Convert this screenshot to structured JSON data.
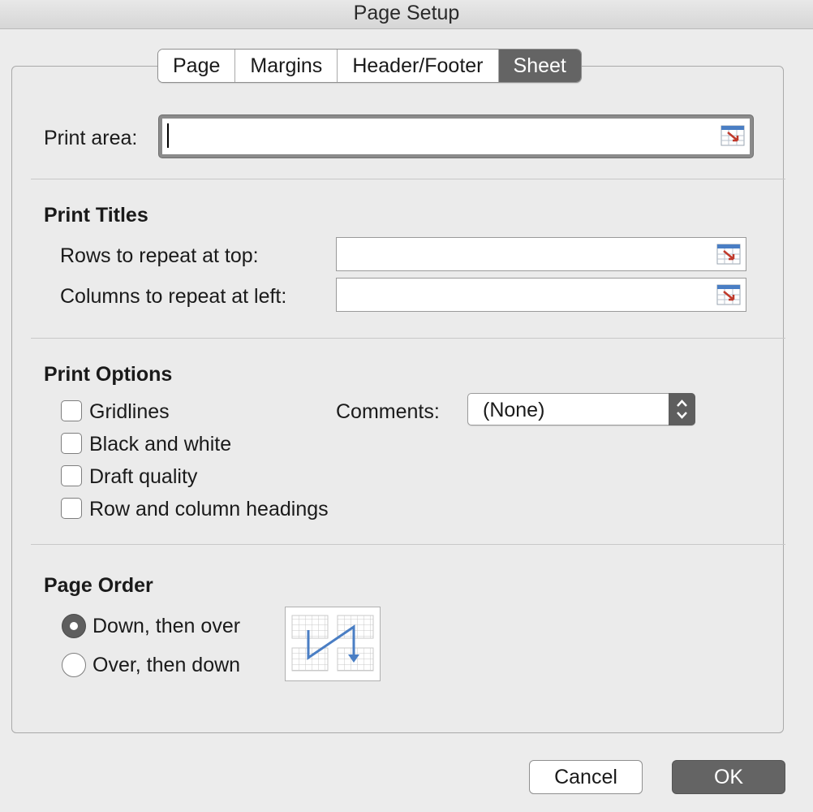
{
  "window": {
    "title": "Page Setup"
  },
  "tabs": [
    {
      "label": "Page"
    },
    {
      "label": "Margins"
    },
    {
      "label": "Header/Footer"
    },
    {
      "label": "Sheet",
      "active": true
    }
  ],
  "print_area": {
    "label": "Print area:",
    "value": ""
  },
  "print_titles": {
    "heading": "Print Titles",
    "rows_label": "Rows to repeat at top:",
    "rows_value": "",
    "columns_label": "Columns to repeat at left:",
    "columns_value": ""
  },
  "print_options": {
    "heading": "Print Options",
    "gridlines": {
      "label": "Gridlines",
      "checked": false
    },
    "black_white": {
      "label": "Black and white",
      "checked": false
    },
    "draft": {
      "label": "Draft quality",
      "checked": false
    },
    "headings": {
      "label": "Row and column headings",
      "checked": false
    },
    "comments_label": "Comments:",
    "comments_value": "(None)"
  },
  "page_order": {
    "heading": "Page Order",
    "down_then_over": {
      "label": "Down, then over",
      "selected": true
    },
    "over_then_down": {
      "label": "Over, then down",
      "selected": false
    }
  },
  "buttons": {
    "cancel": "Cancel",
    "ok": "OK"
  },
  "colors": {
    "accent": "#646464",
    "background": "#ececec",
    "illustration_arrow": "#4a7ec4",
    "ref_icon_red": "#c0392b"
  },
  "icons": {
    "range_picker": "range-picker-icon",
    "select_arrows": "up-down-chevron-icon",
    "page_order_diagram": "page-order-illustration"
  }
}
